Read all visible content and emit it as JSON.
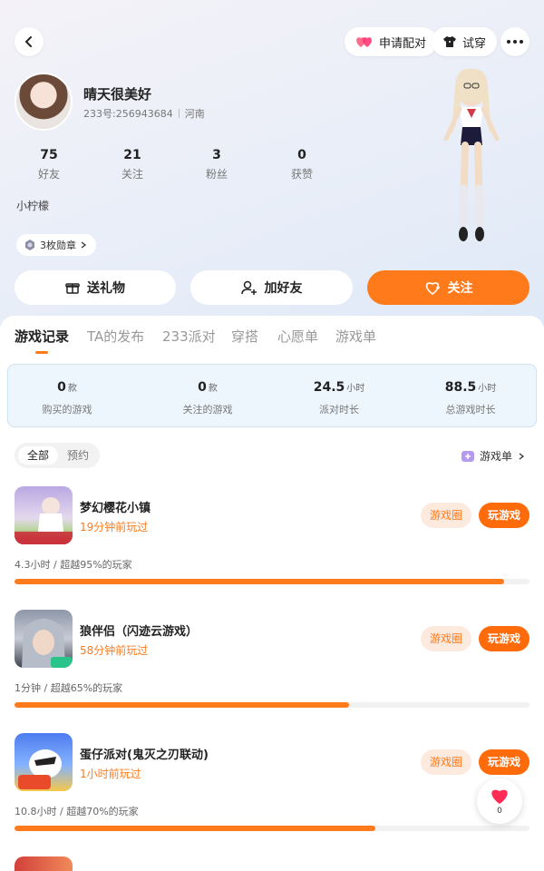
{
  "header": {
    "pair_label": "申请配对",
    "tryon_label": "试穿"
  },
  "profile": {
    "nickname": "晴天很美好",
    "uid": "233号:256943684",
    "region": "河南",
    "bio": "小柠檬",
    "medals": "3枚勋章"
  },
  "stats": [
    {
      "value": "75",
      "label": "好友"
    },
    {
      "value": "21",
      "label": "关注"
    },
    {
      "value": "3",
      "label": "粉丝"
    },
    {
      "value": "0",
      "label": "获赞"
    }
  ],
  "actions": {
    "gift": "送礼物",
    "add_friend": "加好友",
    "follow": "关注"
  },
  "tabs": [
    "游戏记录",
    "TA的发布",
    "233派对",
    "穿搭",
    "心愿单",
    "游戏单"
  ],
  "summary": [
    {
      "value": "0",
      "unit": "款",
      "label": "购买的游戏"
    },
    {
      "value": "0",
      "unit": "款",
      "label": "关注的游戏"
    },
    {
      "value": "24.5",
      "unit": "小时",
      "label": "派对时长"
    },
    {
      "value": "88.5",
      "unit": "小时",
      "label": "总游戏时长"
    }
  ],
  "filter": {
    "all": "全部",
    "reserve": "预约"
  },
  "gamelist_link": "游戏单",
  "games": [
    {
      "title": "梦幻樱花小镇",
      "last_played": "19分钟前玩过",
      "stats": "4.3小时 / 超越95%的玩家",
      "percentile": 0.95,
      "circle_label": "游戏圈",
      "play_label": "玩游戏"
    },
    {
      "title": "狼伴侣（闪迹云游戏）",
      "last_played": "58分钟前玩过",
      "stats": "1分钟 / 超越65%的玩家",
      "percentile": 0.65,
      "circle_label": "游戏圈",
      "play_label": "玩游戏"
    },
    {
      "title": "蛋仔派对(鬼灭之刃联动)",
      "last_played": "1小时前玩过",
      "stats": "10.8小时 / 超越70%的玩家",
      "percentile": 0.7,
      "circle_label": "游戏圈",
      "play_label": "玩游戏"
    }
  ],
  "like_count": "0",
  "colors": {
    "accent": "#ff7a1a",
    "accent_light": "#fdeadf",
    "summary_bg": "#eef6fd",
    "heart": "#ff2d55"
  }
}
